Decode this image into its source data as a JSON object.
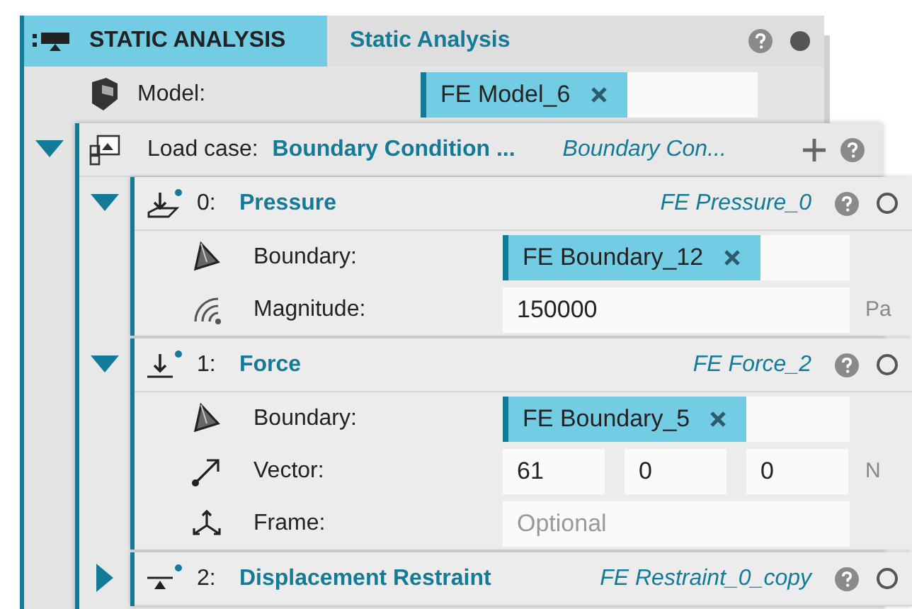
{
  "panel": {
    "tab": "STATIC ANALYSIS",
    "title": "Static Analysis",
    "active": true,
    "model": {
      "label": "Model:",
      "value": "FE Model_6"
    }
  },
  "load_case": {
    "expanded": true,
    "label": "Load case:",
    "value": "Boundary Condition ...",
    "instance": "Boundary Con...",
    "items": [
      {
        "index": "0:",
        "name": "Pressure",
        "instance": "FE Pressure_0",
        "kind": "pressure",
        "expanded": true,
        "active": false,
        "fields": [
          {
            "kind": "boundary",
            "label": "Boundary:",
            "value": "FE Boundary_12"
          },
          {
            "kind": "magnitude",
            "label": "Magnitude:",
            "value": "150000",
            "unit": "Pa"
          }
        ]
      },
      {
        "index": "1:",
        "name": "Force",
        "instance": "FE Force_2",
        "kind": "force",
        "expanded": true,
        "active": false,
        "fields": [
          {
            "kind": "boundary",
            "label": "Boundary:",
            "value": "FE Boundary_5"
          },
          {
            "kind": "vector",
            "label": "Vector:",
            "values": [
              "61",
              "0",
              "0"
            ],
            "unit": "N"
          },
          {
            "kind": "frame",
            "label": "Frame:",
            "placeholder": "Optional"
          }
        ]
      },
      {
        "index": "2:",
        "name": "Displacement Restraint",
        "instance": "FE Restraint_0_copy",
        "kind": "restraint",
        "expanded": false,
        "active": false
      }
    ]
  }
}
